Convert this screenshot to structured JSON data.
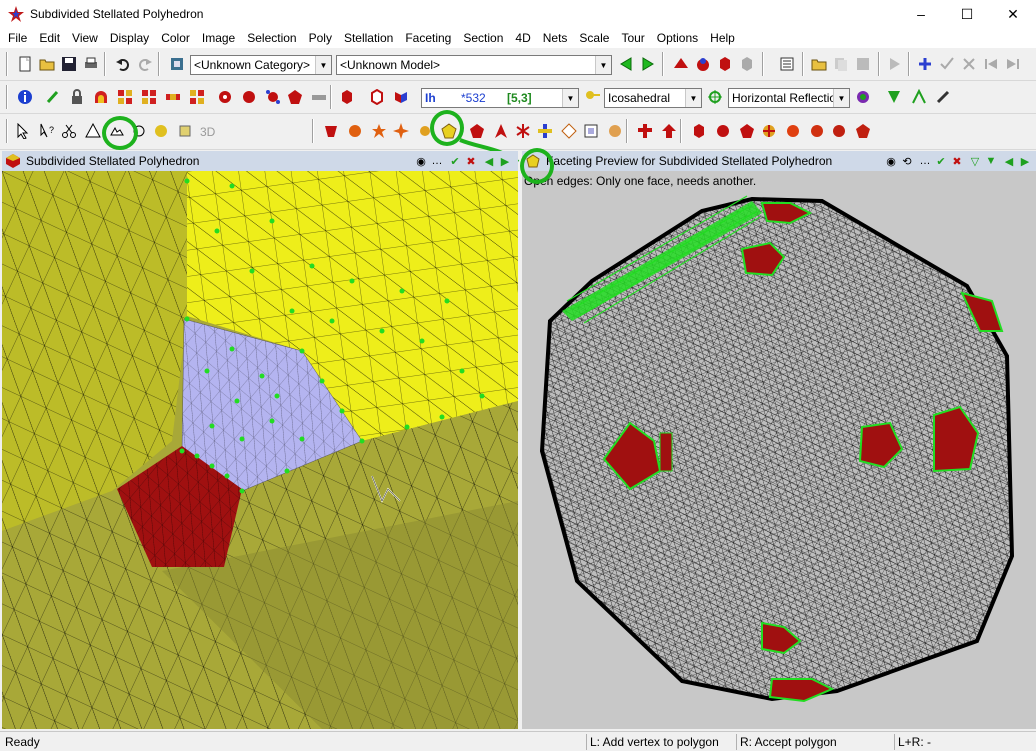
{
  "window": {
    "title": "Subdivided Stellated Polyhedron",
    "minimize": "–",
    "maximize": "☐",
    "close": "✕"
  },
  "menu": [
    "File",
    "Edit",
    "View",
    "Display",
    "Color",
    "Image",
    "Selection",
    "Poly",
    "Stellation",
    "Faceting",
    "Section",
    "4D",
    "Nets",
    "Scale",
    "Tour",
    "Options",
    "Help"
  ],
  "toolbar1": {
    "category": "<Unknown Category>",
    "model": "<Unknown Model>"
  },
  "toolbar2": {
    "symmetry_name": "Ih",
    "symmetry_code": "*532",
    "symmetry_schlafli": "[5,3]",
    "symmetry_type": "Icosahedral",
    "reflection": "Horizontal Reflection"
  },
  "left_pane": {
    "title": "Subdivided Stellated Polyhedron"
  },
  "right_pane": {
    "title": "Faceting Preview for Subdivided Stellated Polyhedron",
    "message": "Open edges: Only one face, needs another."
  },
  "status": {
    "ready": "Ready",
    "left_action": "L: Add vertex to polygon",
    "right_action": "R: Accept polygon",
    "both_action": "L+R: -"
  },
  "colors": {
    "pane_header": "#cfd9e8",
    "highlight": "#1db21d",
    "face_yellow": "#eeee1a",
    "face_olive": "#a8a838",
    "face_red": "#a01010",
    "face_lavender": "#b4b4f0",
    "vertex_green": "#22dd22"
  }
}
